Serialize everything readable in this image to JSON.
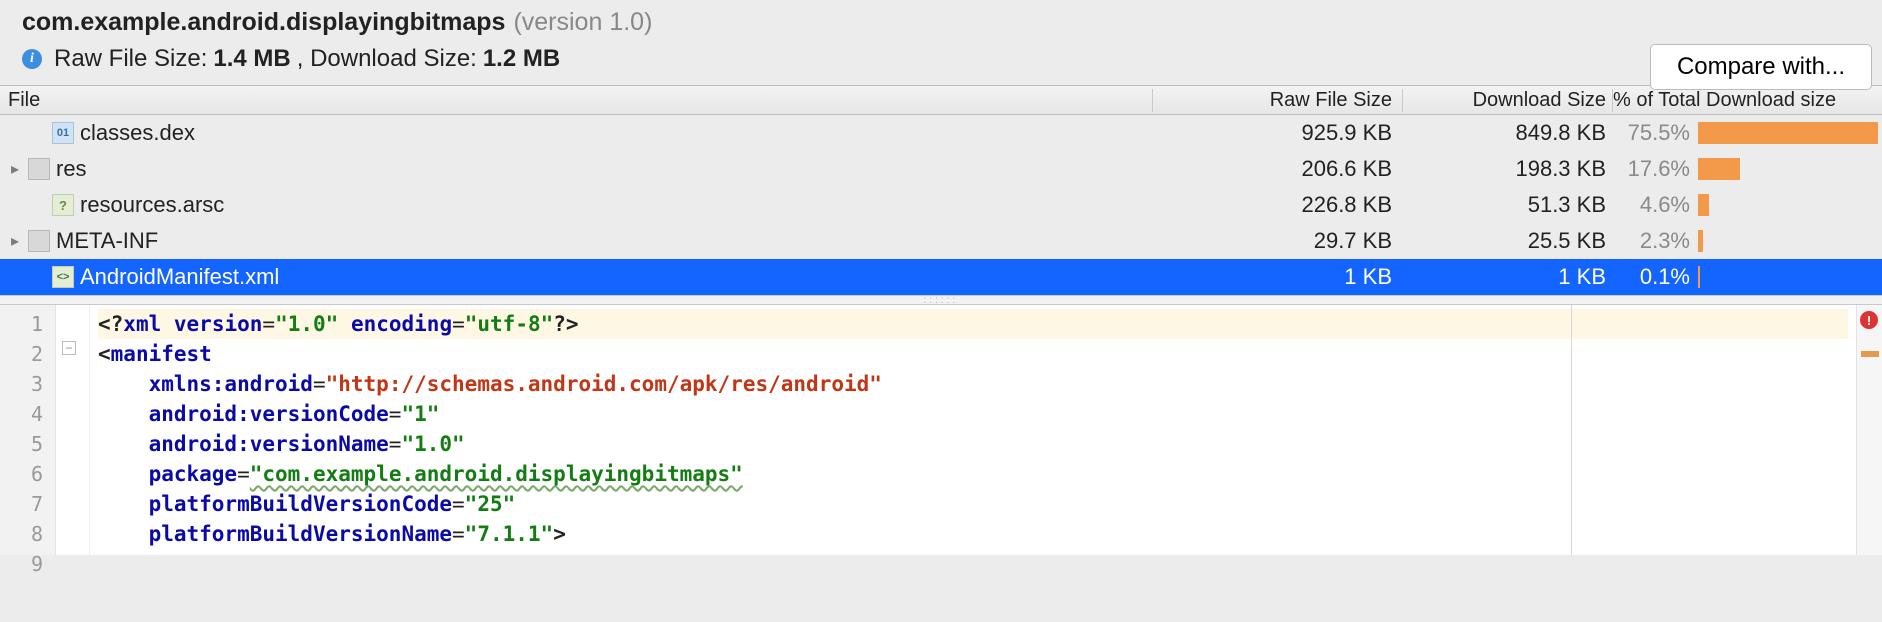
{
  "header": {
    "package_name": "com.example.android.displayingbitmaps",
    "version_label": "(version 1.0)",
    "raw_label": "Raw File Size:",
    "raw_value": "1.4 MB",
    "dl_label": ", Download Size:",
    "dl_value": "1.2 MB",
    "compare_btn": "Compare with..."
  },
  "columns": {
    "file": "File",
    "raw": "Raw File Size",
    "download": "Download Size",
    "pct": "% of Total Download size"
  },
  "rows": [
    {
      "name": "classes.dex",
      "raw": "925.9 KB",
      "dl": "849.8 KB",
      "pct": "75.5%",
      "bar": 75.5,
      "icon": "dex",
      "expandable": false,
      "selected": false,
      "indent": 1
    },
    {
      "name": "res",
      "raw": "206.6 KB",
      "dl": "198.3 KB",
      "pct": "17.6%",
      "bar": 17.6,
      "icon": "folder",
      "expandable": true,
      "selected": false,
      "indent": 0
    },
    {
      "name": "resources.arsc",
      "raw": "226.8 KB",
      "dl": "51.3 KB",
      "pct": "4.6%",
      "bar": 4.6,
      "icon": "arsc",
      "expandable": false,
      "selected": false,
      "indent": 1
    },
    {
      "name": "META-INF",
      "raw": "29.7 KB",
      "dl": "25.5 KB",
      "pct": "2.3%",
      "bar": 2.3,
      "icon": "folder",
      "expandable": true,
      "selected": false,
      "indent": 0
    },
    {
      "name": "AndroidManifest.xml",
      "raw": "1 KB",
      "dl": "1 KB",
      "pct": "0.1%",
      "bar": 0.1,
      "icon": "xml",
      "expandable": false,
      "selected": true,
      "indent": 1
    }
  ],
  "editor": {
    "lines": [
      "1",
      "2",
      "3",
      "4",
      "5",
      "6",
      "7",
      "8",
      "9"
    ],
    "code": {
      "l1_pi_open": "<?",
      "l1_pi_xml": "xml",
      "l1_attr_version": "version",
      "l1_val_version": "\"1.0\"",
      "l1_attr_encoding": "encoding",
      "l1_val_encoding": "\"utf-8\"",
      "l1_pi_close": "?>",
      "l2_open": "<",
      "l2_tag": "manifest",
      "l3_attr": "xmlns:android",
      "l3_val": "\"http://schemas.android.com/apk/res/android\"",
      "l4_attr": "android:versionCode",
      "l4_val": "\"1\"",
      "l5_attr": "android:versionName",
      "l5_val": "\"1.0\"",
      "l6_attr": "package",
      "l6_val": "\"com.example.android.displayingbitmaps\"",
      "l7_attr": "platformBuildVersionCode",
      "l7_val": "\"25\"",
      "l8_attr": "platformBuildVersionName",
      "l8_val": "\"7.1.1\"",
      "l8_close": ">"
    }
  }
}
